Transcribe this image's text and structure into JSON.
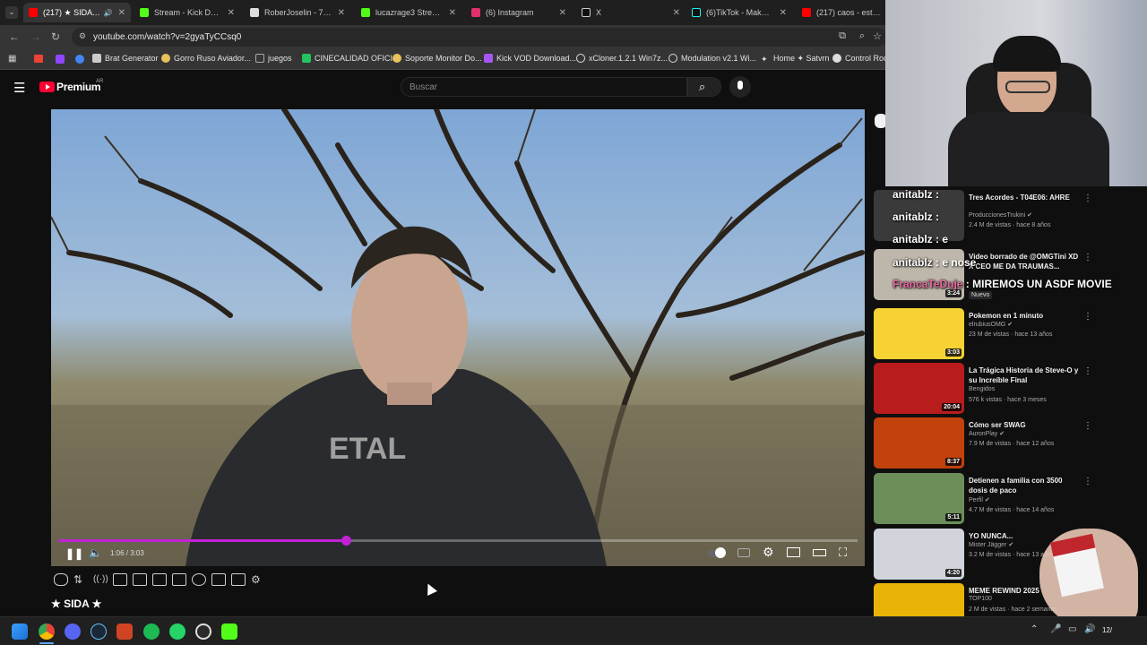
{
  "tabs": [
    {
      "label": "(217) ★ SIDA ★",
      "active": true,
      "color": "#ff0000"
    },
    {
      "label": "Stream - Kick Dashbo",
      "color": "#53fc18"
    },
    {
      "label": "RoberJoselin - 7TV",
      "color": "#ffffff"
    },
    {
      "label": "lucazrage3 Stream - ",
      "color": "#53fc18"
    },
    {
      "label": "(6) Instagram",
      "color": "#e1306c"
    },
    {
      "label": "X",
      "color": "#ffffff"
    },
    {
      "label": "(6)TikTok - Make Your",
      "color": "#ffffff"
    },
    {
      "label": "(217) caos - estylo p",
      "color": "#ff0000"
    }
  ],
  "address": {
    "url": "youtube.com/watch?v=2gyaTyCCsq0"
  },
  "bookmarks": [
    {
      "label": "Brat Generator",
      "color": "#cccccc"
    },
    {
      "label": "Gorro Ruso Aviador...",
      "color": "#e8c15a"
    },
    {
      "label": "juegos",
      "color": "#aaaaaa"
    },
    {
      "label": "CINECALIDAD OFICI...",
      "color": "#22c55e"
    },
    {
      "label": "Soporte Monitor Do...",
      "color": "#e8c15a"
    },
    {
      "label": "Kick VOD Download...",
      "color": "#a855f7"
    },
    {
      "label": "xCloner.1.2.1 Win7z...",
      "color": "#dddddd"
    },
    {
      "label": "Modulation v2.1 Wi...",
      "color": "#dddddd"
    },
    {
      "label": "Home ✦ Satvrn",
      "color": "#dddddd"
    },
    {
      "label": "Control Room",
      "color": "#dddddd"
    }
  ],
  "youtube": {
    "logo_text": "Premium",
    "region": "AR",
    "search_placeholder": "Buscar",
    "brand_color": "#ff0033"
  },
  "player": {
    "time": "1:06 / 3:03",
    "progress": 0.36,
    "accent": "#c222d6"
  },
  "video_title": "★ SIDA ★",
  "chat_overlay": [
    {
      "user": "anitablz",
      "msg": ""
    },
    {
      "user": "anitablz",
      "msg": ""
    },
    {
      "user": "anitablz",
      "msg": "e"
    },
    {
      "user": "anitablz",
      "msg": "e nose"
    },
    {
      "user": "FrancaTeDuje",
      "msg": "MIREMOS UN ASDF MOVIE"
    }
  ],
  "recommendations": [
    {
      "title": "Tres Acordes - T04E06: AHRE",
      "channel": "ProduccionesTrukini",
      "meta": "2.4 M de vistas · hace 8 años",
      "duration": "",
      "verified": true,
      "thumb": "#3a3a3a"
    },
    {
      "title": "Video borrado de @OMGTini XD X CEO ME DA TRAUMAS...",
      "channel": "",
      "meta": "Nuevo",
      "duration": "3:24",
      "verified": false,
      "thumb": "#bdb6aa"
    },
    {
      "title": "Pokemon en 1 minuto",
      "channel": "elrubiusOMG",
      "meta": "23 M de vistas · hace 13 años",
      "duration": "3:03",
      "verified": true,
      "thumb": "#f7d233"
    },
    {
      "title": "La Trágica Historia de Steve-O y su Increíble Final",
      "channel": "Bengidos",
      "meta": "576 k vistas · hace 3 meses",
      "duration": "20:04",
      "verified": false,
      "thumb": "#b91c1c"
    },
    {
      "title": "Cómo ser SWAG",
      "channel": "AuronPlay",
      "meta": "7.9 M de vistas · hace 12 años",
      "duration": "8:37",
      "verified": true,
      "thumb": "#c2410c"
    },
    {
      "title": "Detienen a familia con 3500 dosis de paco",
      "channel": "Perfil",
      "meta": "4.7 M de vistas · hace 14 años",
      "duration": "5:11",
      "verified": true,
      "thumb": "#6b8e5a"
    },
    {
      "title": "YO NUNCA...",
      "channel": "Mister Jägger",
      "meta": "3.2 M de vistas · hace 13 años",
      "duration": "4:20",
      "verified": true,
      "thumb": "#d1d5db"
    },
    {
      "title": "MEME REWIND 2025",
      "channel": "TOP100",
      "meta": "2 M de vistas · hace 2 semanas",
      "duration": "",
      "verified": false,
      "thumb": "#eab308"
    }
  ],
  "taskbar": {
    "clock": "12/",
    "apps": [
      "windows-start",
      "chrome",
      "discord",
      "steam",
      "office",
      "spotify",
      "whatsapp",
      "obs",
      "kick"
    ]
  }
}
